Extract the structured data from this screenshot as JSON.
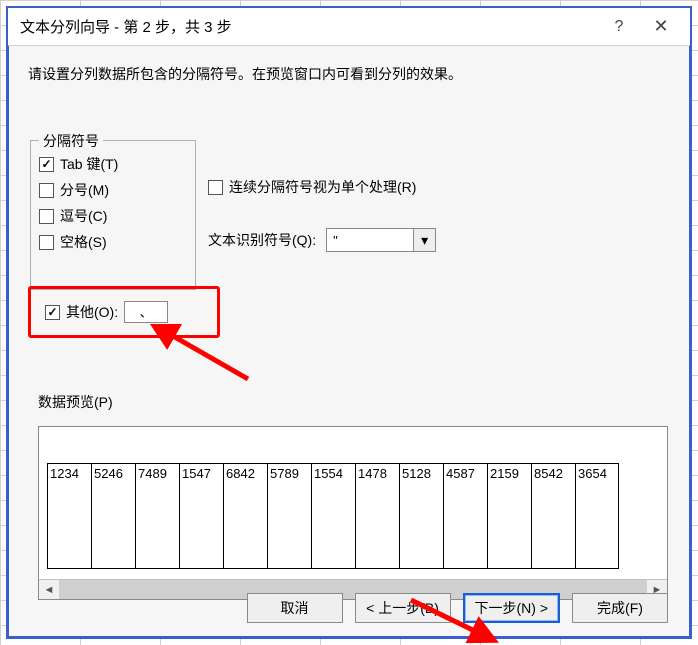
{
  "titlebar": {
    "title": "文本分列向导 - 第 2 步，共 3 步",
    "help": "?",
    "close": "✕"
  },
  "instruction": "请设置分列数据所包含的分隔符号。在预览窗口内可看到分列的效果。",
  "delimiters": {
    "legend": "分隔符号",
    "tab": "Tab 键(T)",
    "semicolon": "分号(M)",
    "comma": "逗号(C)",
    "space": "空格(S)",
    "other": "其他(O):",
    "other_value": "、"
  },
  "right": {
    "consecutive": "连续分隔符号视为单个处理(R)",
    "text_qualifier_label": "文本识别符号(Q):",
    "text_qualifier_value": "\""
  },
  "preview": {
    "label": "数据预览(P)",
    "columns": [
      "1234",
      "5246",
      "7489",
      "1547",
      "6842",
      "5789",
      "1554",
      "1478",
      "5128",
      "4587",
      "2159",
      "8542",
      "3654"
    ]
  },
  "buttons": {
    "cancel": "取消",
    "back": "< 上一步(B)",
    "next": "下一步(N) >",
    "finish": "完成(F)"
  },
  "icons": {
    "dropdown": "▾",
    "scroll_left": "◄",
    "scroll_right": "►"
  }
}
